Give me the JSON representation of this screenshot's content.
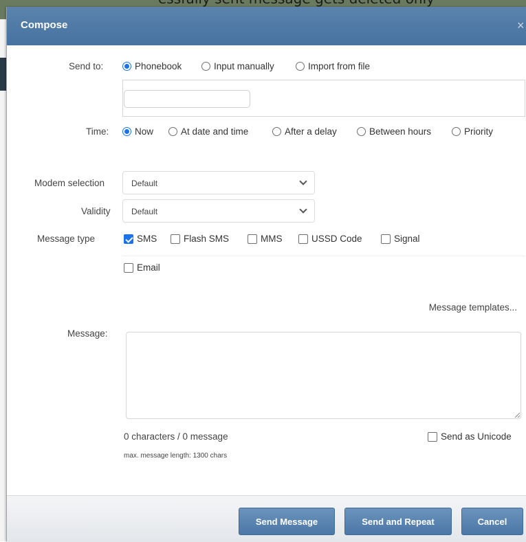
{
  "background": {
    "top_text": "essfully sent message gets deleted only"
  },
  "dialog": {
    "title": "Compose",
    "close_glyph": "×",
    "send_to": {
      "label": "Send to:",
      "options": [
        "Phonebook",
        "Input manually",
        "Import from file"
      ],
      "selected": "Phonebook",
      "recipient_value": ""
    },
    "time": {
      "label": "Time:",
      "options": [
        "Now",
        "At date and time",
        "After a delay",
        "Between hours",
        "Priority"
      ],
      "selected": "Now"
    },
    "modem": {
      "label": "Modem selection",
      "value": "Default"
    },
    "validity": {
      "label": "Validity",
      "value": "Default"
    },
    "message_type": {
      "label": "Message type",
      "options": [
        {
          "label": "SMS",
          "checked": true
        },
        {
          "label": "Flash SMS",
          "checked": false
        },
        {
          "label": "MMS",
          "checked": false
        },
        {
          "label": "USSD Code",
          "checked": false
        },
        {
          "label": "Signal",
          "checked": false
        },
        {
          "label": "Email",
          "checked": false
        }
      ]
    },
    "templates_link": "Message templates...",
    "message": {
      "label": "Message:",
      "value": ""
    },
    "counter": "0 characters / 0 message",
    "max_length": "max. message length: 1300 chars",
    "unicode": {
      "label": "Send as Unicode",
      "checked": false
    },
    "buttons": {
      "send": "Send Message",
      "send_repeat": "Send and Repeat",
      "cancel": "Cancel"
    }
  },
  "colors": {
    "accent": "#1a73e8",
    "titlebar": "#4f79a5",
    "button": "#5a84b0"
  }
}
